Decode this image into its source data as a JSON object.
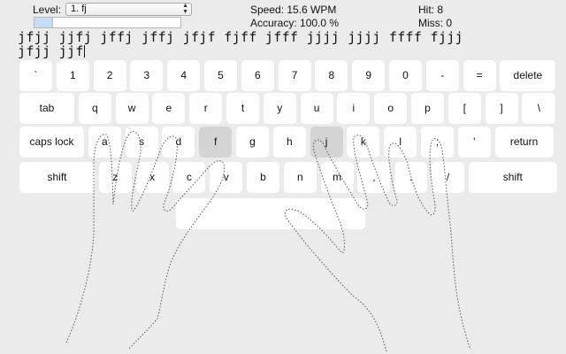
{
  "stats": {
    "level_label": "Level:",
    "level_value": "1. fj",
    "progress_fraction": 0.12,
    "speed": "Speed: 15.6 WPM",
    "accuracy": "Accuracy: 100.0 %",
    "hit": "Hit: 8",
    "miss": "Miss: 0"
  },
  "practice": {
    "line1": "jfjj jjfj jffj jffj jfjf fjff jfff jjjj jjjj ffff fjjj",
    "line2": "jfjj jjf"
  },
  "keyboard": {
    "rows": [
      [
        {
          "label": "`",
          "name": "key-backtick"
        },
        {
          "label": "1",
          "name": "key-1"
        },
        {
          "label": "2",
          "name": "key-2"
        },
        {
          "label": "3",
          "name": "key-3"
        },
        {
          "label": "4",
          "name": "key-4"
        },
        {
          "label": "5",
          "name": "key-5"
        },
        {
          "label": "6",
          "name": "key-6"
        },
        {
          "label": "7",
          "name": "key-7"
        },
        {
          "label": "8",
          "name": "key-8"
        },
        {
          "label": "9",
          "name": "key-9"
        },
        {
          "label": "0",
          "name": "key-0"
        },
        {
          "label": "-",
          "name": "key-minus"
        },
        {
          "label": "=",
          "name": "key-equals"
        },
        {
          "label": "delete",
          "name": "key-delete"
        }
      ],
      [
        {
          "label": "tab",
          "name": "key-tab"
        },
        {
          "label": "q",
          "name": "key-q"
        },
        {
          "label": "w",
          "name": "key-w"
        },
        {
          "label": "e",
          "name": "key-e"
        },
        {
          "label": "r",
          "name": "key-r"
        },
        {
          "label": "t",
          "name": "key-t"
        },
        {
          "label": "y",
          "name": "key-y"
        },
        {
          "label": "u",
          "name": "key-u"
        },
        {
          "label": "i",
          "name": "key-i"
        },
        {
          "label": "o",
          "name": "key-o"
        },
        {
          "label": "p",
          "name": "key-p"
        },
        {
          "label": "[",
          "name": "key-lbracket"
        },
        {
          "label": "]",
          "name": "key-rbracket"
        },
        {
          "label": "\\",
          "name": "key-backslash"
        }
      ],
      [
        {
          "label": "caps lock",
          "name": "key-caps-lock"
        },
        {
          "label": "a",
          "name": "key-a"
        },
        {
          "label": "s",
          "name": "key-s"
        },
        {
          "label": "d",
          "name": "key-d"
        },
        {
          "label": "f",
          "name": "key-f",
          "home": true
        },
        {
          "label": "g",
          "name": "key-g"
        },
        {
          "label": "h",
          "name": "key-h"
        },
        {
          "label": "j",
          "name": "key-j",
          "home": true
        },
        {
          "label": "k",
          "name": "key-k"
        },
        {
          "label": "l",
          "name": "key-l"
        },
        {
          "label": ";",
          "name": "key-semicolon"
        },
        {
          "label": "'",
          "name": "key-quote"
        },
        {
          "label": "return",
          "name": "key-return"
        }
      ],
      [
        {
          "label": "shift",
          "name": "key-shift-left"
        },
        {
          "label": "z",
          "name": "key-z"
        },
        {
          "label": "x",
          "name": "key-x"
        },
        {
          "label": "c",
          "name": "key-c"
        },
        {
          "label": "v",
          "name": "key-v"
        },
        {
          "label": "b",
          "name": "key-b"
        },
        {
          "label": "n",
          "name": "key-n"
        },
        {
          "label": "m",
          "name": "key-m"
        },
        {
          "label": ",",
          "name": "key-comma"
        },
        {
          "label": ".",
          "name": "key-period"
        },
        {
          "label": "/",
          "name": "key-slash"
        },
        {
          "label": "shift",
          "name": "key-shift-right"
        }
      ],
      [
        {
          "label": "",
          "name": "key-space"
        }
      ]
    ]
  },
  "colors": {
    "background": "#ebebeb",
    "key": "#ffffff",
    "home_key": "#d4d4d4",
    "progress_fill": "#c7dcf5"
  }
}
